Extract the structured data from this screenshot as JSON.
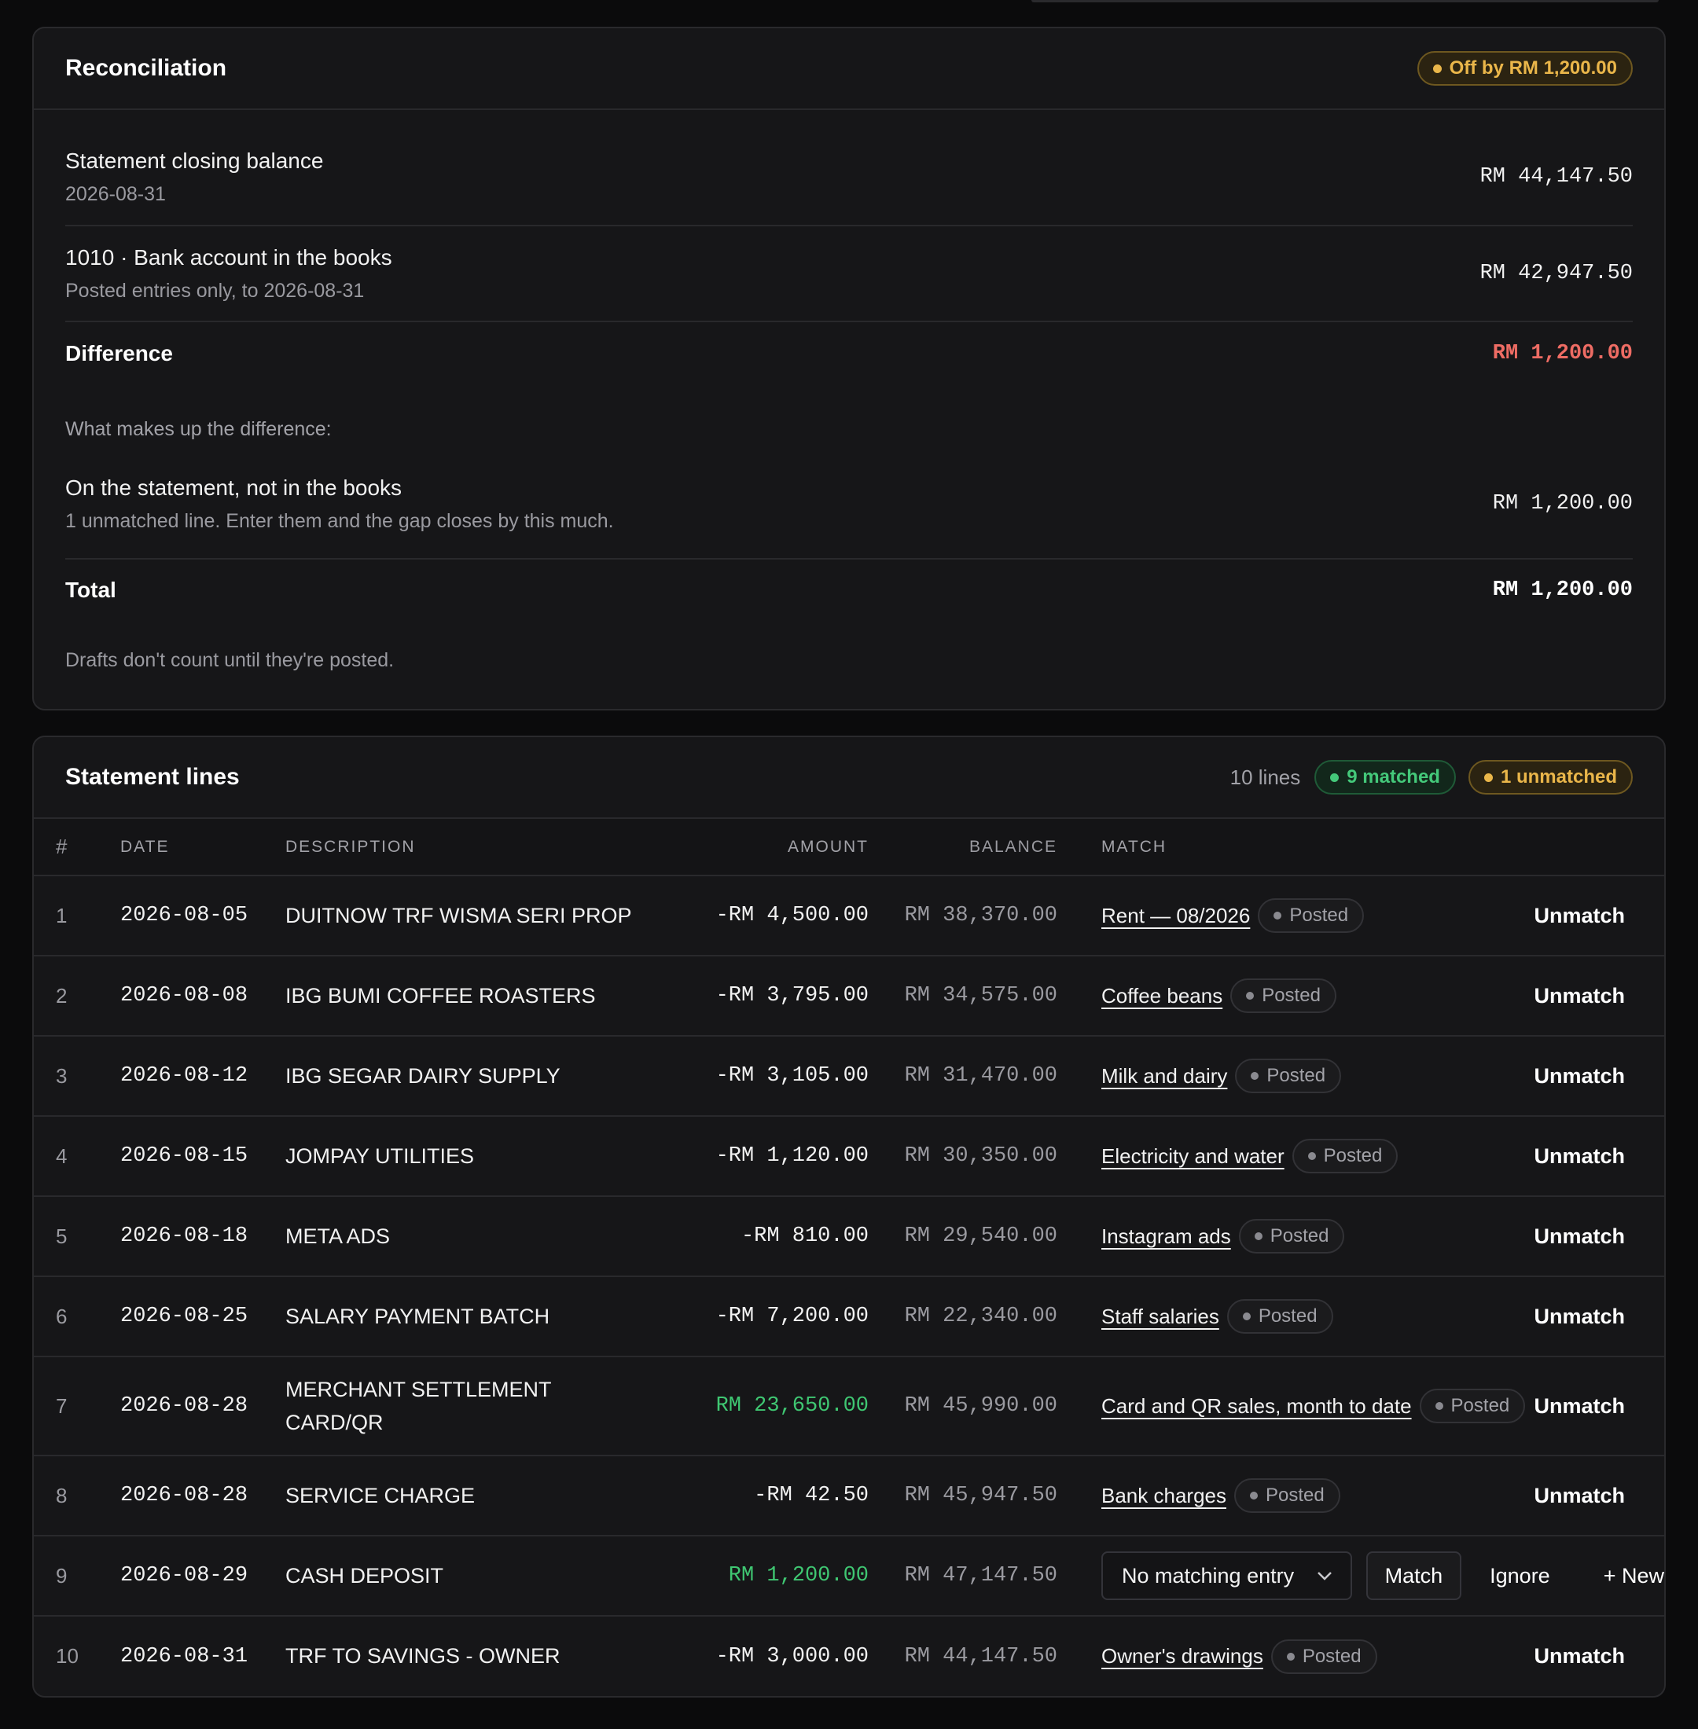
{
  "reconciliation": {
    "title": "Reconciliation",
    "status_badge": "Off by RM 1,200.00",
    "statement_closing": {
      "label": "Statement closing balance",
      "sub": "2026-08-31",
      "amount": "RM 44,147.50"
    },
    "books": {
      "label": "1010 · Bank account in the books",
      "sub": "Posted entries only, to 2026-08-31",
      "amount": "RM 42,947.50"
    },
    "difference": {
      "label": "Difference",
      "amount": "RM 1,200.00"
    },
    "makes_up": "What makes up the difference:",
    "not_in_books": {
      "label": "On the statement, not in the books",
      "sub": "1 unmatched line. Enter them and the gap closes by this much.",
      "amount": "RM 1,200.00"
    },
    "total": {
      "label": "Total",
      "amount": "RM 1,200.00"
    },
    "drafts_note": "Drafts don't count until they're posted.",
    "colors": {
      "warn": "#eab64a",
      "negative": "#ee6c64"
    }
  },
  "statement_lines": {
    "title": "Statement lines",
    "count": "10 lines",
    "matched_badge": "9 matched",
    "unmatched_badge": "1 unmatched",
    "columns": [
      "#",
      "DATE",
      "DESCRIPTION",
      "AMOUNT",
      "BALANCE",
      "MATCH"
    ],
    "posted_label": "Posted",
    "unmatch_label": "Unmatch",
    "rows": [
      {
        "num": "1",
        "date": "2026-08-05",
        "desc": "DUITNOW TRF WISMA SERI PROP",
        "amount": "-RM 4,500.00",
        "balance": "RM 38,370.00",
        "match": "Rent — 08/2026"
      },
      {
        "num": "2",
        "date": "2026-08-08",
        "desc": "IBG BUMI COFFEE ROASTERS",
        "amount": "-RM 3,795.00",
        "balance": "RM 34,575.00",
        "match": "Coffee beans"
      },
      {
        "num": "3",
        "date": "2026-08-12",
        "desc": "IBG SEGAR DAIRY SUPPLY",
        "amount": "-RM 3,105.00",
        "balance": "RM 31,470.00",
        "match": "Milk and dairy"
      },
      {
        "num": "4",
        "date": "2026-08-15",
        "desc": "JOMPAY UTILITIES",
        "amount": "-RM 1,120.00",
        "balance": "RM 30,350.00",
        "match": "Electricity and water"
      },
      {
        "num": "5",
        "date": "2026-08-18",
        "desc": "META ADS",
        "amount": "-RM 810.00",
        "balance": "RM 29,540.00",
        "match": "Instagram ads"
      },
      {
        "num": "6",
        "date": "2026-08-25",
        "desc": "SALARY PAYMENT BATCH",
        "amount": "-RM 7,200.00",
        "balance": "RM 22,340.00",
        "match": "Staff salaries"
      },
      {
        "num": "7",
        "date": "2026-08-28",
        "desc": "MERCHANT SETTLEMENT CARD/QR",
        "amount": "RM 23,650.00",
        "balance": "RM 45,990.00",
        "match": "Card and QR sales, month to date"
      },
      {
        "num": "8",
        "date": "2026-08-28",
        "desc": "SERVICE CHARGE",
        "amount": "-RM 42.50",
        "balance": "RM 45,947.50",
        "match": "Bank charges"
      },
      {
        "num": "9",
        "date": "2026-08-29",
        "desc": "CASH DEPOSIT",
        "amount": "RM 1,200.00",
        "balance": "RM 47,147.50",
        "select_value": "No matching entry",
        "match_btn": "Match",
        "ignore_btn": "Ignore",
        "new_btn": "+ New"
      },
      {
        "num": "10",
        "date": "2026-08-31",
        "desc": "TRF TO SAVINGS - OWNER",
        "amount": "-RM 3,000.00",
        "balance": "RM 44,147.50",
        "match": "Owner's drawings"
      }
    ],
    "colors": {
      "positive": "#3fc772",
      "matched": "#44c97a",
      "unmatched": "#eab64a"
    }
  }
}
